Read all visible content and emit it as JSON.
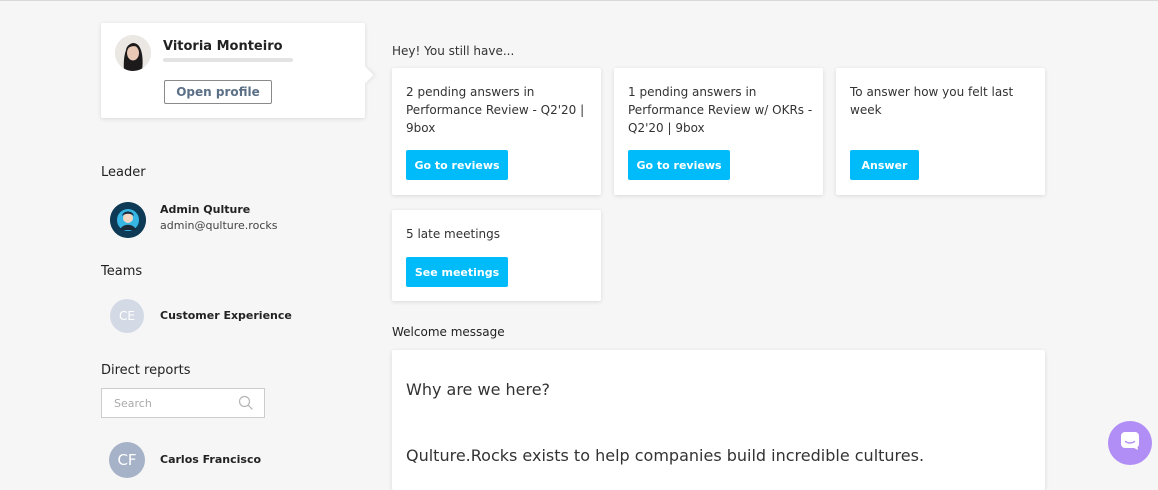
{
  "profile": {
    "name": "Vitoria Monteiro",
    "open_profile_label": "Open profile"
  },
  "leader": {
    "section_title": "Leader",
    "name": "Admin Qulture",
    "email": "admin@qulture.rocks"
  },
  "teams": {
    "section_title": "Teams",
    "items": [
      {
        "initials": "CE",
        "name": "Customer Experience"
      }
    ]
  },
  "direct_reports": {
    "section_title": "Direct reports",
    "search_placeholder": "Search",
    "items": [
      {
        "initials": "CF",
        "name": "Carlos Francisco"
      }
    ]
  },
  "pending": {
    "greeting": "Hey! You still have...",
    "cards": [
      {
        "text": "2 pending answers in Performance Review - Q2'20 | 9box",
        "button": "Go to reviews"
      },
      {
        "text": "1 pending answers in Performance Review w/ OKRs - Q2'20 | 9box",
        "button": "Go to reviews"
      },
      {
        "text": "To answer how you felt last week",
        "button": "Answer"
      },
      {
        "text": "5 late meetings",
        "button": "See meetings"
      }
    ]
  },
  "welcome": {
    "section_title": "Welcome message",
    "heading": "Why are we here?",
    "body": "Qulture.Rocks exists to help companies build incredible cultures."
  },
  "colors": {
    "accent": "#00bbf9",
    "chat": "#b18ef6",
    "background": "#f6f6f6"
  },
  "icons": {
    "search": "search-icon",
    "chat": "chat-icon"
  }
}
